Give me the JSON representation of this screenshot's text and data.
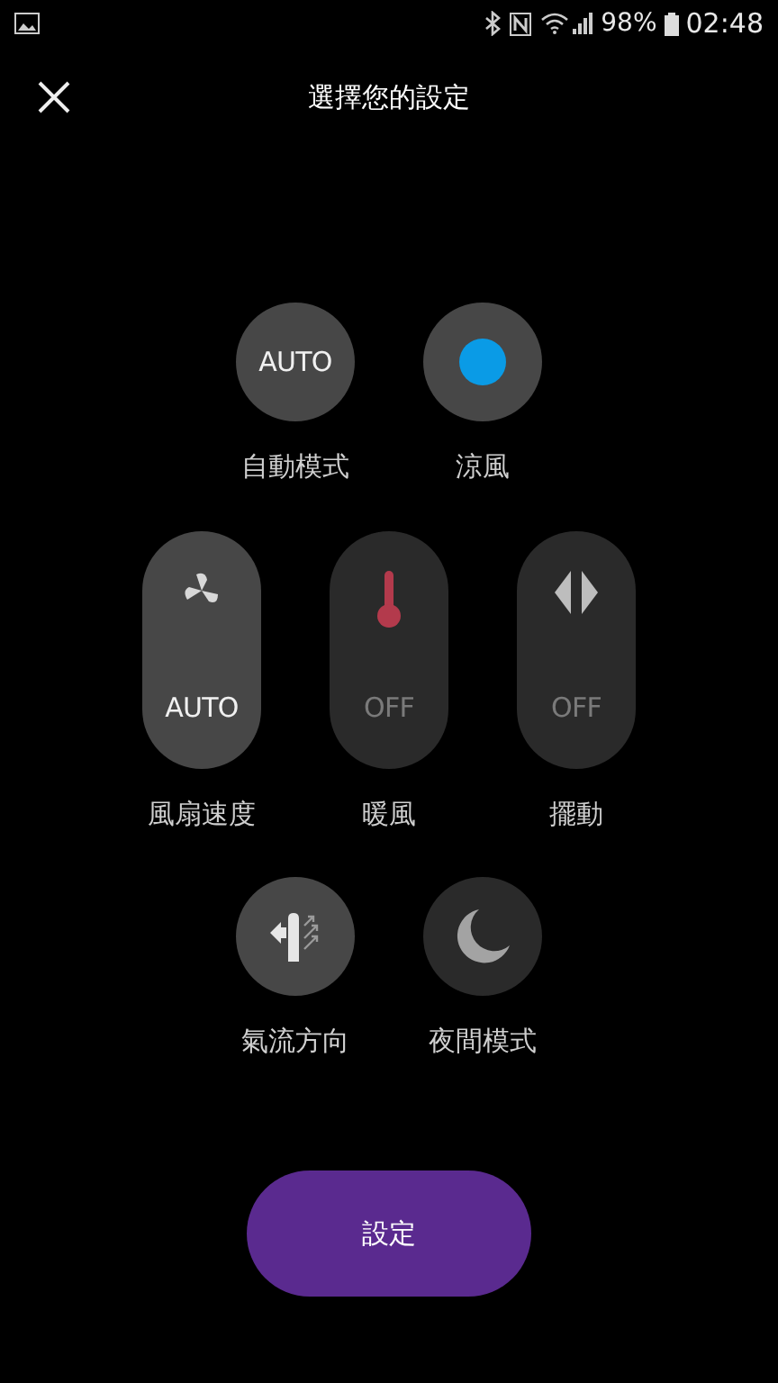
{
  "status_bar": {
    "battery": "98%",
    "time": "02:48"
  },
  "header": {
    "title": "選擇您的設定"
  },
  "rows": [
    {
      "controls": [
        {
          "kind": "auto",
          "on": true,
          "value": "AUTO",
          "label": "自動模式"
        },
        {
          "kind": "cool",
          "on": true,
          "label": "涼風"
        }
      ]
    },
    {
      "controls": [
        {
          "kind": "fan",
          "on": true,
          "value": "AUTO",
          "label": "風扇速度"
        },
        {
          "kind": "heat",
          "on": false,
          "value": "OFF",
          "label": "暖風"
        },
        {
          "kind": "swing",
          "on": false,
          "value": "OFF",
          "label": "擺動"
        }
      ]
    },
    {
      "controls": [
        {
          "kind": "airflow",
          "on": true,
          "label": "氣流方向"
        },
        {
          "kind": "night",
          "on": false,
          "label": "夜間模式"
        }
      ]
    }
  ],
  "confirm_button": {
    "label": "設定"
  }
}
